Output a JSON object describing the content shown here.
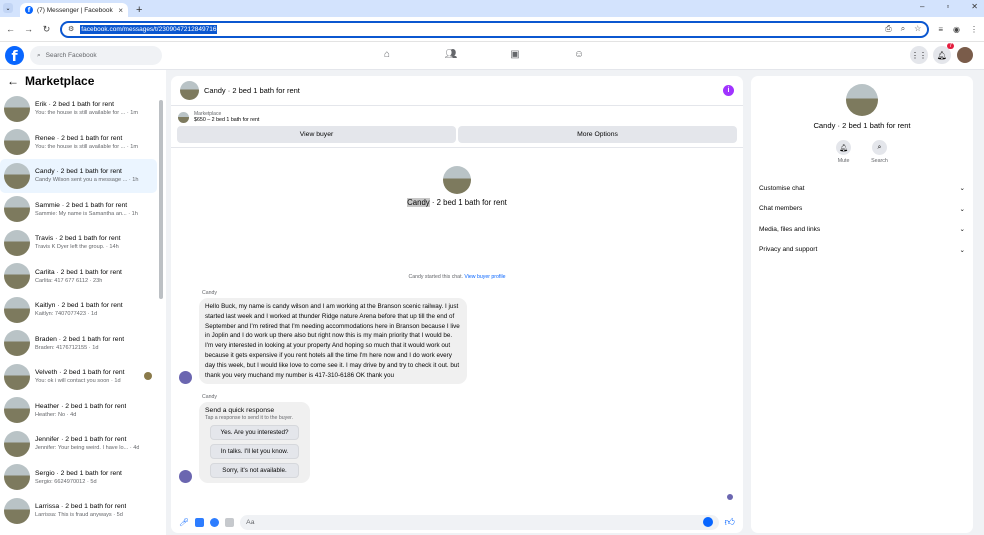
{
  "browser": {
    "tab_title": "(7) Messenger | Facebook",
    "url": "facebook.com/messages/t/2309047212849716"
  },
  "fb": {
    "search_placeholder": "Search Facebook",
    "notification_count": "7"
  },
  "sidebar": {
    "title": "Marketplace",
    "conversations": [
      {
        "name": "Erik · 2 bed 1 bath for rent",
        "preview": "You: the house is still available for ... · 1m"
      },
      {
        "name": "Renee · 2 bed 1 bath for rent",
        "preview": "You: the house is still available for ... · 1m"
      },
      {
        "name": "Candy · 2 bed 1 bath for rent",
        "preview": "Candy Wilson sent you a message ... · 1h"
      },
      {
        "name": "Sammie · 2 bed 1 bath for rent",
        "preview": "Sammie: My name is Samantha an... · 1h"
      },
      {
        "name": "Travis · 2 bed 1 bath for rent",
        "preview": "Travis K Dyer left the group. · 14h"
      },
      {
        "name": "Carlita · 2 bed 1 bath for rent",
        "preview": "Carlita: 417 677 6112 · 23h"
      },
      {
        "name": "Kaitlyn · 2 bed 1 bath for rent",
        "preview": "Kaitlyn: 7407077423 · 1d"
      },
      {
        "name": "Braden · 2 bed 1 bath for rent",
        "preview": "Braden: 4176712155 · 1d"
      },
      {
        "name": "Velveth · 2 bed 1 bath for rent",
        "preview": "You: ok i will contact you soon · 1d"
      },
      {
        "name": "Heather · 2 bed 1 bath for rent",
        "preview": "Heather: No · 4d"
      },
      {
        "name": "Jennifer · 2 bed 1 bath for rent",
        "preview": "Jennifer: Your being weird. I have lo... · 4d"
      },
      {
        "name": "Sergio · 2 bed 1 bath for rent",
        "preview": "Sergio: 6624970012 · 5d"
      },
      {
        "name": "Larrissa · 2 bed 1 bath for rent",
        "preview": "Larrissa: This is fraud anyways · 5d"
      }
    ]
  },
  "chat": {
    "title": "Candy · 2 bed 1 bath for rent",
    "listing_label": "Marketplace",
    "listing_price": "$650 – 2 bed 1 bath for rent",
    "view_buyer": "View buyer",
    "more_options": "More Options",
    "center_name_hl": "Candy",
    "center_name_rest": " · 2 bed 1 bath for rent",
    "started_text": "Candy started this chat. ",
    "view_profile": "View buyer profile",
    "sender1": "Candy",
    "message": "Hello Buck, my name is candy wilson and I am working at the Branson scenic railway. I just started last week and I worked at thunder Ridge nature Arena before that up till the end of September and I'm retired that I'm needing accommodations here in Branson because I live in Joplin and I do work up there also but right now this is my main priority that I would be. I'm very interested in looking at your property And hoping so much that it would work out because it gets expensive if you rent hotels all the time I'm here now and I do work every day this week, but I would like love to come see it. I may drive by and try to check it out. but thank you very muchand my number is 417-310-6186 OK thank you",
    "sender2": "Candy",
    "qr_title": "Send a quick response",
    "qr_sub": "Tap a response to send it to the buyer.",
    "qr_options": [
      "Yes. Are you interested?",
      "In talks. I'll let you know.",
      "Sorry, it's not available."
    ],
    "input_placeholder": "Aa"
  },
  "right": {
    "name": "Candy · 2 bed 1 bath for rent",
    "mute": "Mute",
    "search": "Search",
    "sections": [
      "Customise chat",
      "Chat members",
      "Media, files and links",
      "Privacy and support"
    ]
  },
  "colors": {
    "accent": "#0866ff",
    "info": "#a033ff"
  }
}
